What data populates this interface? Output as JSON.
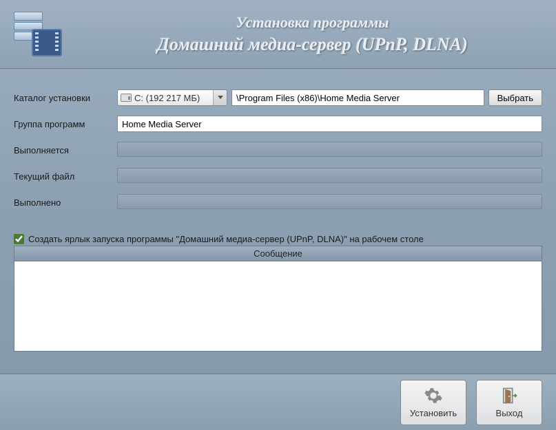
{
  "header": {
    "title1": "Установка программы",
    "title2": "Домашний медиа-сервер (UPnP, DLNA)"
  },
  "form": {
    "install_dir_label": "Каталог установки",
    "drive_text": "C: (192 217 МБ)",
    "install_path": "\\Program Files (x86)\\Home Media Server",
    "browse_btn": "Выбрать",
    "program_group_label": "Группа программ",
    "program_group_value": "Home Media Server",
    "executing_label": "Выполняется",
    "current_file_label": "Текущий файл",
    "completed_label": "Выполнено"
  },
  "checkbox": {
    "checked": true,
    "label": "Создать ярлык запуска программы \"Домашний медиа-сервер (UPnP, DLNA)\" на рабочем столе"
  },
  "messages": {
    "header": "Сообщение"
  },
  "footer": {
    "install_btn": "Установить",
    "exit_btn": "Выход"
  }
}
